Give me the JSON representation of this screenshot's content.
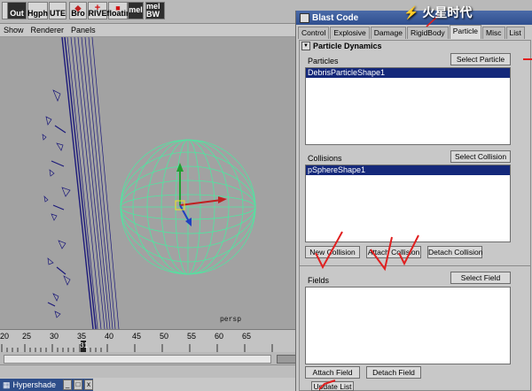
{
  "shelf": {
    "buttons": [
      {
        "label": "E"
      },
      {
        "label": "Out"
      },
      {
        "label": "Hgph"
      },
      {
        "label": "UTE"
      },
      {
        "label": "Bro"
      },
      {
        "label": "RIVE"
      },
      {
        "label": "floatir"
      },
      {
        "label": "mel"
      },
      {
        "label": "mel"
      }
    ],
    "sub_label": "BW"
  },
  "panel_menu": [
    "Show",
    "Renderer",
    "Panels"
  ],
  "viewport": {
    "camera_label": "persp"
  },
  "timeline": {
    "ticks": [
      "20",
      "25",
      "30",
      "35",
      "40",
      "45",
      "50",
      "55",
      "60",
      "65"
    ],
    "current_frame": "31"
  },
  "hypershade": {
    "title": "Hypershade",
    "buttons": [
      "_",
      "□",
      "x"
    ]
  },
  "watermark": "⚡ 火星时代",
  "blast_code": {
    "title": "Blast Code",
    "tabs": [
      "Control",
      "Explosive",
      "Damage",
      "RigidBody",
      "Particle",
      "Misc",
      "List"
    ],
    "active_tab": "Particle",
    "section": "Particle Dynamics",
    "particles": {
      "label": "Particles",
      "button": "Select Particle",
      "items": [
        "DebrisParticleShape1"
      ]
    },
    "collisions": {
      "label": "Collisions",
      "button": "Select Collision",
      "items": [
        "pSphereShape1"
      ],
      "buttons": [
        "New Collision",
        "Attach Collision",
        "Detach Collision"
      ]
    },
    "fields": {
      "label": "Fields",
      "button": "Select Field",
      "items": [],
      "buttons": [
        "Attach Field",
        "Detach Field"
      ],
      "update_button": "Update List"
    }
  },
  "colors": {
    "title_bar": "#2f4f8f",
    "selection": "#14287a",
    "wireframe_sphere": "#4fe6a0",
    "debris": "#1c1a7a",
    "annotation": "#e02020"
  }
}
